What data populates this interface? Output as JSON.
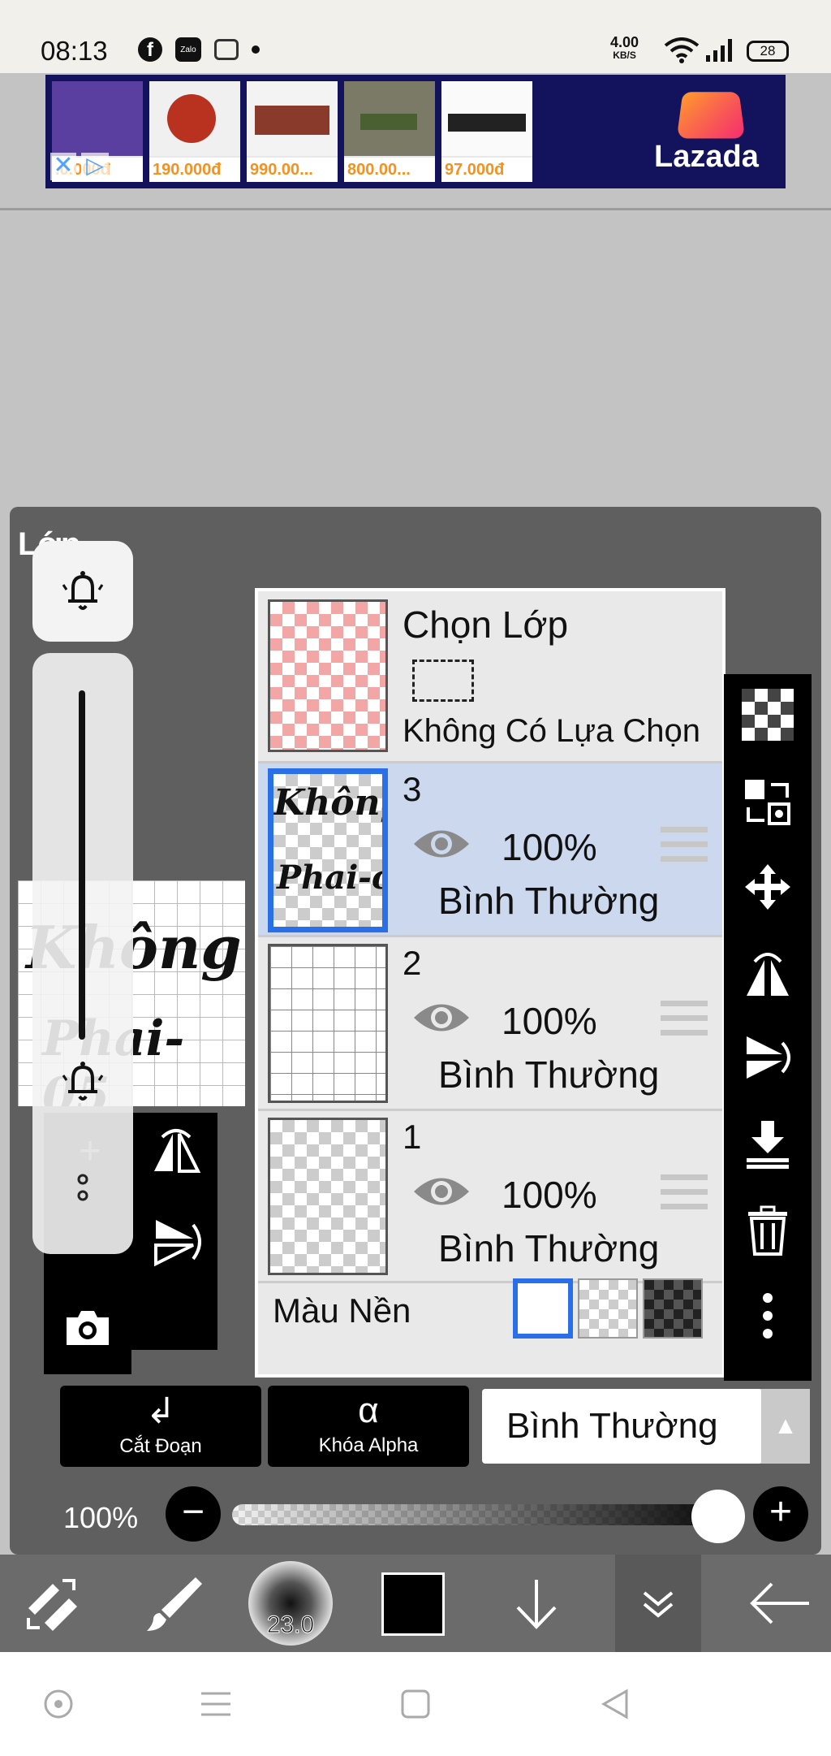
{
  "status_bar": {
    "time": "08:13",
    "facebook_glyph": "f",
    "zalo_label": "Zalo",
    "net_speed_value": "4.00",
    "net_speed_unit": "KB/S",
    "battery": "28",
    "icons": [
      "facebook-icon",
      "zalo-icon",
      "notification-icon",
      "dot-icon",
      "wifi-icon",
      "signal-icon",
      "battery-icon"
    ]
  },
  "ad": {
    "brand": "Lazada",
    "close_glyph": "✕",
    "play_glyph": "▷",
    "products": [
      {
        "price": ".0.000đ",
        "color": "#5b3fa0"
      },
      {
        "price": "190.000đ",
        "color": "#b8321f"
      },
      {
        "price": "990.00...",
        "color": "#8a3a2a"
      },
      {
        "price": "800.00...",
        "color": "#4a6030"
      },
      {
        "price": "97.000đ",
        "color": "#222222"
      }
    ]
  },
  "panel": {
    "title": "Lớp",
    "preview_text_1": "Không",
    "preview_text_2": "Phai-05"
  },
  "notification_pill": {
    "bell_glyph": "🔔",
    "more_glyph": "⋮"
  },
  "side_tools": {
    "flip_h_glyph": "⇋",
    "flip_v_glyph": "⇵",
    "add_glyph": "+",
    "camera_glyph": "📷"
  },
  "layers": {
    "selection_row": {
      "title": "Chọn Lớp",
      "status": "Không Có Lựa Chọn"
    },
    "items": [
      {
        "number": "3",
        "opacity": "100%",
        "blend": "Bình Thường",
        "selected": true,
        "thumb_text_1": "Không",
        "thumb_text_2": "Phai-c"
      },
      {
        "number": "2",
        "opacity": "100%",
        "blend": "Bình Thường",
        "selected": false
      },
      {
        "number": "1",
        "opacity": "100%",
        "blend": "Bình Thường",
        "selected": false
      }
    ],
    "background_label": "Màu Nền"
  },
  "right_toolbar": {
    "buttons": [
      "checker-icon",
      "transform-layer-icon",
      "move-icon",
      "flip-horizontal-icon",
      "flip-vertical-icon",
      "merge-down-icon",
      "delete-icon",
      "more-icon"
    ]
  },
  "controls": {
    "clip_label": "Cắt Đoạn",
    "clip_glyph": "↲",
    "alpha_lock_label": "Khóa Alpha",
    "alpha_lock_glyph": "α",
    "blend_mode": "Bình Thường",
    "blend_arrow": "▲",
    "opacity_label": "100%",
    "opacity_value": 1.0,
    "minus": "−",
    "plus": "+"
  },
  "bottom_toolbar": {
    "brush_size": "23.0",
    "color": "#000000"
  },
  "colors": {
    "accent": "#2a6ee8",
    "selected_row": "#cbd8ee",
    "panel": "#5f5f5f"
  }
}
